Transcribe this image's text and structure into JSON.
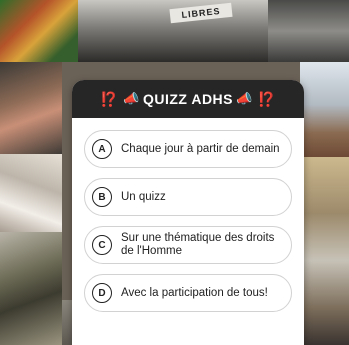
{
  "background": {
    "sign_text": "LIBRES"
  },
  "quiz": {
    "header": {
      "prefix": "⁉️",
      "emoji_left": "📣",
      "title": "QUIZZ ADHS",
      "emoji_right": "📣",
      "suffix": "⁉️"
    },
    "options": [
      {
        "letter": "A",
        "text": "Chaque jour à partir de demain"
      },
      {
        "letter": "B",
        "text": "Un quizz"
      },
      {
        "letter": "C",
        "text": "Sur une thématique des droits de l'Homme"
      },
      {
        "letter": "D",
        "text": "Avec la participation de tous!"
      }
    ]
  },
  "colors": {
    "header_bg": "#262626",
    "accent_red": "#e8453c",
    "option_border": "#d2d2d2"
  }
}
